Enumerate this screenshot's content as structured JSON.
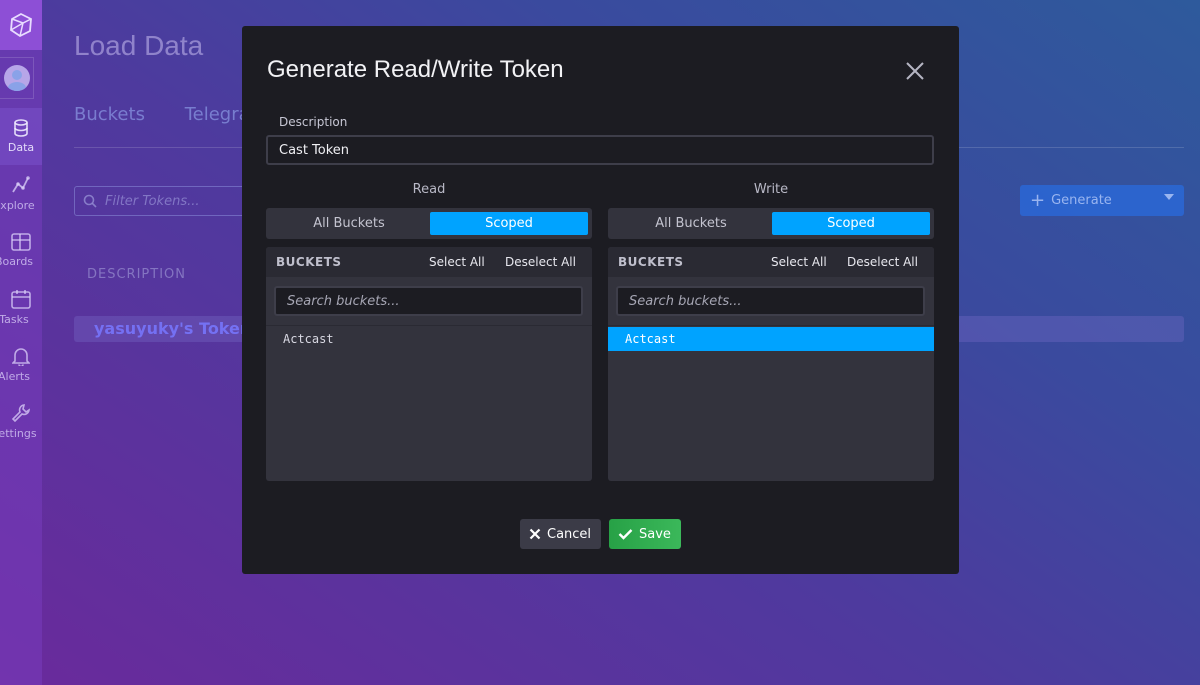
{
  "background": {
    "page_title": "Load Data",
    "tabs": [
      "Buckets",
      "Telegra"
    ],
    "filter_placeholder": "Filter Tokens...",
    "generate_label": "Generate",
    "column_header": "DESCRIPTION",
    "token_row": "yasuyuky's Token",
    "sidebar": {
      "items": [
        {
          "label": "Data",
          "icon": "database-icon"
        },
        {
          "label": "Explore",
          "icon": "explore-graph-icon"
        },
        {
          "label": "Boards",
          "icon": "dashboard-grid-icon"
        },
        {
          "label": "Tasks",
          "icon": "calendar-icon"
        },
        {
          "label": "Alerts",
          "icon": "bell-icon"
        },
        {
          "label": "Settings",
          "icon": "wrench-icon"
        }
      ]
    }
  },
  "modal": {
    "title": "Generate Read/Write Token",
    "description_label": "Description",
    "description_value": "Cast Token",
    "read": {
      "heading": "Read",
      "toggle_all": "All Buckets",
      "toggle_scoped": "Scoped",
      "buckets_header": "BUCKETS",
      "select_all": "Select All",
      "deselect_all": "Deselect All",
      "search_placeholder": "Search buckets...",
      "items": [
        {
          "name": "Actcast",
          "selected": false
        }
      ]
    },
    "write": {
      "heading": "Write",
      "toggle_all": "All Buckets",
      "toggle_scoped": "Scoped",
      "buckets_header": "BUCKETS",
      "select_all": "Select All",
      "deselect_all": "Deselect All",
      "search_placeholder": "Search buckets...",
      "items": [
        {
          "name": "Actcast",
          "selected": true
        }
      ]
    },
    "cancel_label": "Cancel",
    "save_label": "Save"
  },
  "colors": {
    "accent": "#00a3ff",
    "save": "#2da44e",
    "modal_bg": "#1c1c22"
  }
}
